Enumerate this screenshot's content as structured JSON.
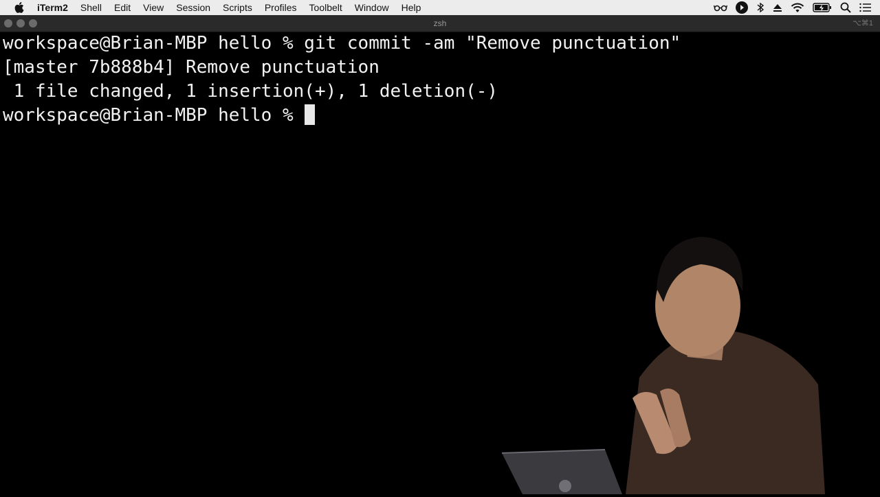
{
  "menubar": {
    "app_name": "iTerm2",
    "items": [
      "Shell",
      "Edit",
      "View",
      "Session",
      "Scripts",
      "Profiles",
      "Toolbelt",
      "Window",
      "Help"
    ],
    "status_icons": [
      "glasses-icon",
      "play-icon",
      "bluetooth-icon",
      "eject-icon",
      "wifi-icon",
      "battery-icon",
      "search-icon",
      "list-icon"
    ]
  },
  "window": {
    "title": "zsh",
    "shortcut": "⌥⌘1"
  },
  "terminal": {
    "lines": [
      "workspace@Brian-MBP hello % git commit -am \"Remove punctuation\"",
      "[master 7b888b4] Remove punctuation",
      " 1 file changed, 1 insertion(+), 1 deletion(-)"
    ],
    "prompt": "workspace@Brian-MBP hello %"
  },
  "colors": {
    "background": "#000000",
    "text": "#f2f2f2",
    "menubar": "#ececec",
    "titlebar": "#2a2a2a"
  }
}
